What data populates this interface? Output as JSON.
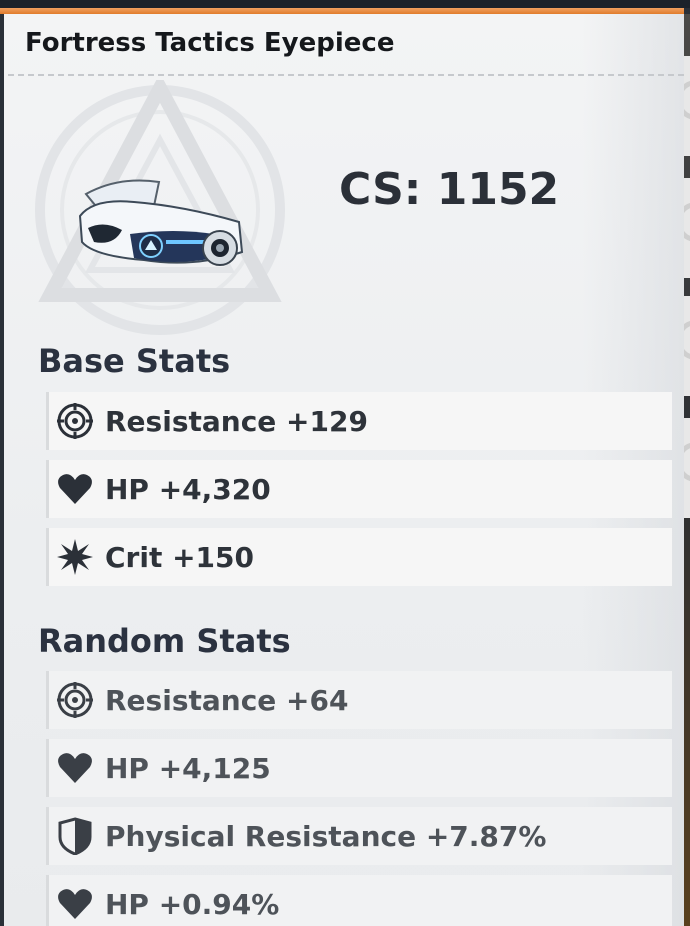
{
  "item": {
    "name": "Fortress Tactics Eyepiece",
    "combat_score": "CS: 1152"
  },
  "base_stats": {
    "title": "Base Stats",
    "rows": [
      {
        "icon": "resistance-icon",
        "text": "Resistance +129"
      },
      {
        "icon": "hp-heart-icon",
        "text": "HP +4,320"
      },
      {
        "icon": "crit-burst-icon",
        "text": "Crit +150"
      }
    ]
  },
  "random_stats": {
    "title": "Random Stats",
    "rows": [
      {
        "icon": "resistance-icon",
        "text": "Resistance +64"
      },
      {
        "icon": "hp-heart-icon",
        "text": "HP +4,125"
      },
      {
        "icon": "physical-resistance-shield-icon",
        "text": "Physical Resistance +7.87%"
      },
      {
        "icon": "hp-heart-icon",
        "text": "HP +0.94%"
      }
    ]
  },
  "colors": {
    "accent": "#e07c2c",
    "panel": "#eceef0",
    "text": "#2e333a"
  }
}
